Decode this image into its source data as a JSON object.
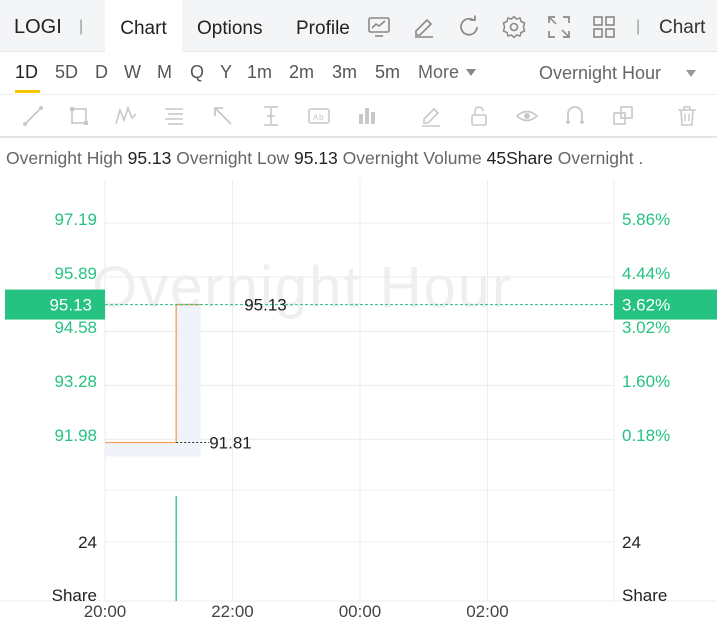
{
  "header": {
    "ticker": "LOGI",
    "separator": "|",
    "tabs": [
      {
        "label": "Chart"
      },
      {
        "label": "Options"
      },
      {
        "label": "Profile"
      }
    ],
    "right_label": "Chart",
    "icons": [
      "chart-type-icon",
      "draw-icon",
      "refresh-icon",
      "settings-icon",
      "fullscreen-icon",
      "layout-grid-icon"
    ]
  },
  "periods": {
    "items": [
      "1D",
      "5D",
      "D",
      "W",
      "M",
      "Q",
      "Y",
      "1m",
      "2m",
      "3m",
      "5m"
    ],
    "active": "1D",
    "more_label": "More",
    "session_label": "Overnight Hour"
  },
  "toolbar": {
    "tools": [
      "trend-line-icon",
      "rectangle-icon",
      "wave-icon",
      "fib-icon",
      "arrow-icon",
      "price-range-icon",
      "text-note-icon",
      "bars-pattern-icon",
      "pencil-icon",
      "lock-icon",
      "eye-icon",
      "magnet-icon",
      "layers-icon",
      "trash-icon"
    ]
  },
  "info": {
    "high_label": "Overnight High",
    "high_value": "95.13",
    "low_label": "Overnight Low",
    "low_value": "95.13",
    "volume_label": "Overnight Volume",
    "volume_value": "45Share",
    "trailing_label": "Overnight ."
  },
  "chart_data": {
    "type": "line",
    "watermark": "Overnight Hour",
    "x_ticks": [
      "20:00",
      "22:00",
      "00:00",
      "02:00"
    ],
    "y_ticks_left": [
      "97.19",
      "95.89",
      "94.58",
      "93.28",
      "91.98"
    ],
    "y_ticks_right": [
      "5.86%",
      "4.44%",
      "3.02%",
      "1.60%",
      "0.18%"
    ],
    "price_series": {
      "x": [
        "20:00",
        "21:07",
        "21:07",
        "21:30"
      ],
      "y": [
        91.81,
        91.81,
        95.13,
        95.13
      ]
    },
    "current_price": "95.13",
    "current_change": "3.62%",
    "low_annotation": "91.81",
    "high_annotation": "95.13",
    "volume": {
      "x": [
        "21:07"
      ],
      "y": [
        45
      ]
    },
    "volume_ticks_left": [
      "24",
      "Share"
    ],
    "volume_ticks_right": [
      "24",
      "Share"
    ],
    "colors": {
      "up": "#26c281",
      "line": "#f0a060",
      "grid": "#ececec"
    }
  }
}
